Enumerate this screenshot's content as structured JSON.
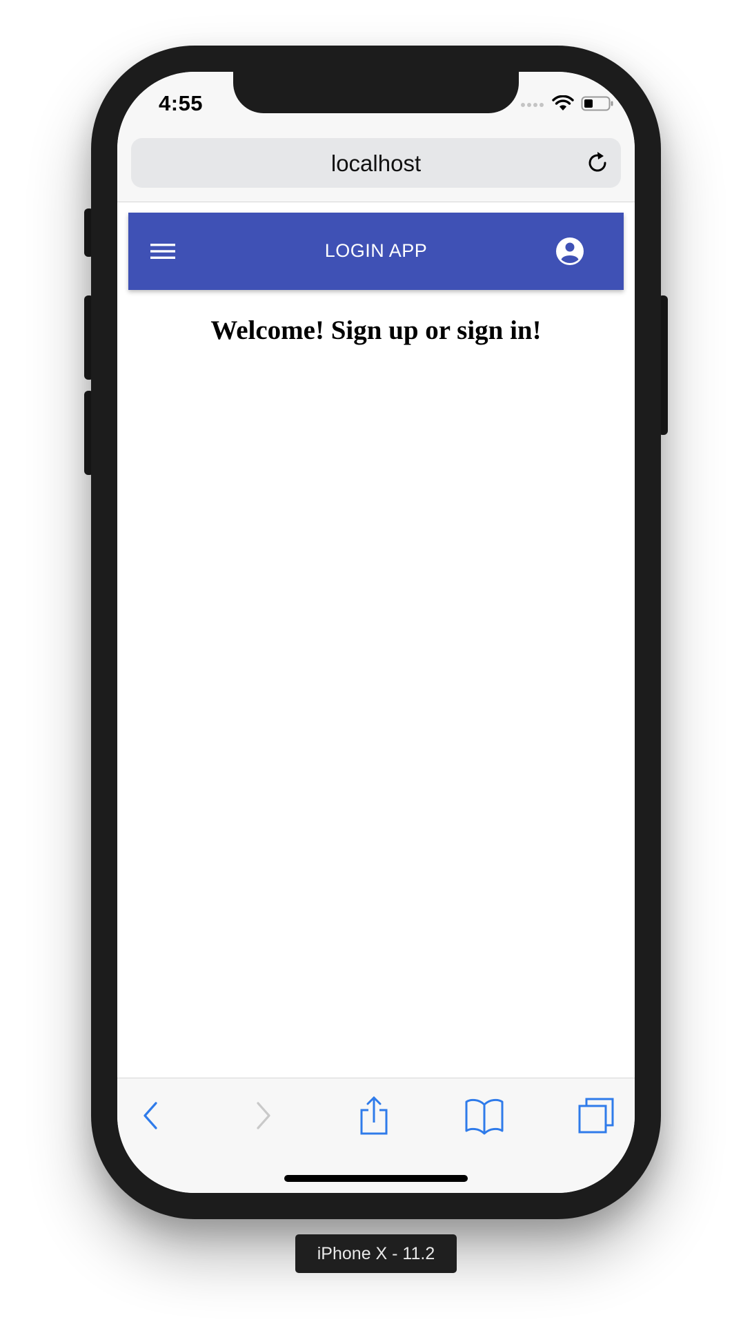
{
  "status_bar": {
    "time": "4:55",
    "icons": [
      "cellular-signal-icon",
      "wifi-icon",
      "battery-icon"
    ]
  },
  "browser": {
    "url": "localhost",
    "toolbar_icons": [
      "back-icon",
      "forward-icon",
      "share-icon",
      "bookmarks-icon",
      "tabs-icon"
    ]
  },
  "app_bar": {
    "title": "LOGIN APP",
    "menu_icon": "hamburger-menu-icon",
    "account_icon": "account-circle-icon",
    "color": "#3f51b5"
  },
  "main": {
    "welcome": "Welcome! Sign up or sign in!"
  },
  "simulator": {
    "device_label": "iPhone X - 11.2"
  },
  "colors": {
    "accent_blue": "#2f7bea",
    "device_frame": "#1c1c1c"
  }
}
